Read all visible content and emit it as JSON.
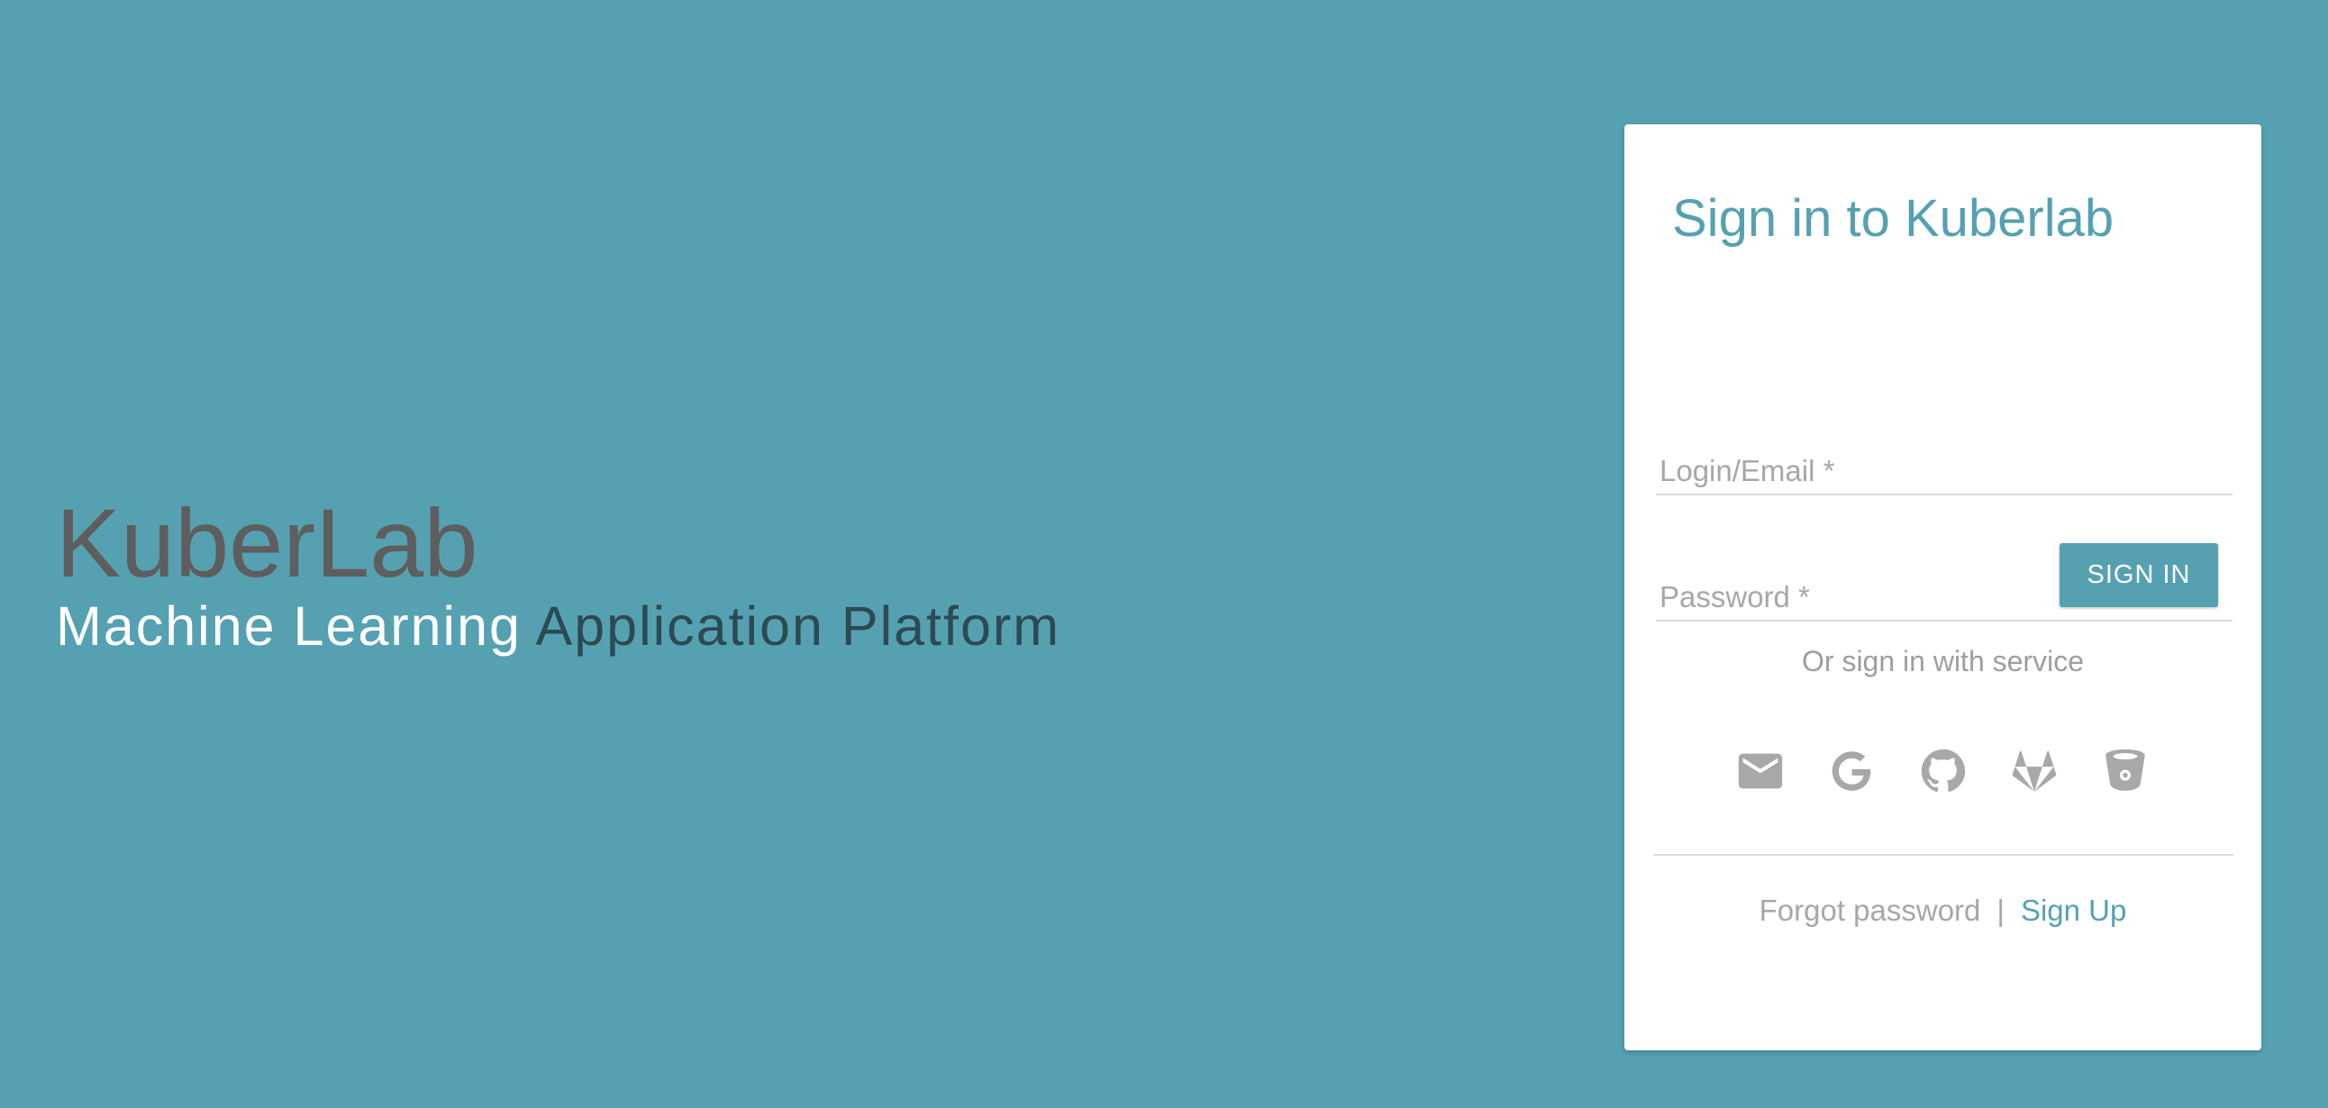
{
  "hero": {
    "title": "KuberLab",
    "subtitle_light": "Machine Learning",
    "subtitle_dark": "Application Platform"
  },
  "login_card": {
    "title": "Sign in to Kuberlab",
    "login_placeholder": "Login/Email *",
    "password_placeholder": "Password *",
    "sign_in_label": "SIGN IN",
    "or_service_text": "Or sign in with service",
    "services": [
      {
        "name": "email",
        "icon": "mail-icon"
      },
      {
        "name": "google",
        "icon": "google-icon"
      },
      {
        "name": "github",
        "icon": "github-icon"
      },
      {
        "name": "gitlab",
        "icon": "gitlab-icon"
      },
      {
        "name": "bitbucket",
        "icon": "bitbucket-icon"
      }
    ],
    "forgot_label": "Forgot password",
    "separator": "|",
    "signup_label": "Sign Up"
  },
  "colors": {
    "background": "#55a1b2",
    "accent": "#55a1b2",
    "icon_gray": "#a8a8a8",
    "hero_title": "#5e5e5e"
  }
}
